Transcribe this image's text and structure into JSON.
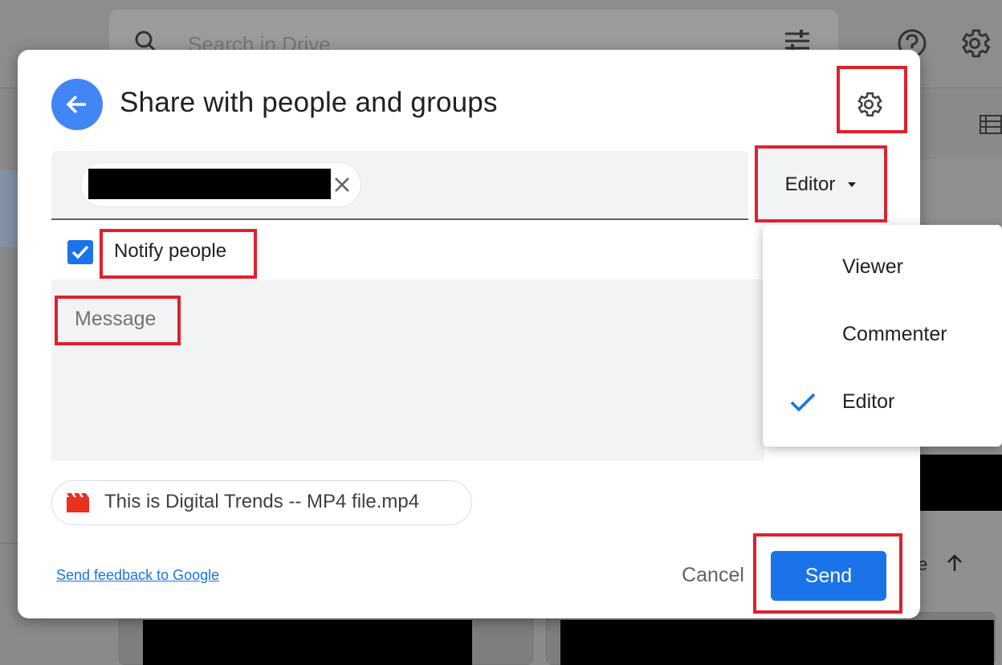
{
  "background": {
    "search_placeholder": "Search in Drive",
    "partial_text": "e"
  },
  "dialog": {
    "title": "Share with people and groups",
    "recipient_chip": {
      "redacted": true
    },
    "role_selector": {
      "selected": "Editor"
    },
    "notify": {
      "label": "Notify people",
      "checked": true
    },
    "message": {
      "placeholder": "Message"
    },
    "attachment": {
      "file_name": "This is Digital Trends -- MP4 file.mp4"
    },
    "footer": {
      "feedback_link": "Send feedback to Google",
      "cancel_label": "Cancel",
      "send_label": "Send"
    }
  },
  "role_menu": {
    "items": [
      {
        "label": "Viewer",
        "selected": false
      },
      {
        "label": "Commenter",
        "selected": false
      },
      {
        "label": "Editor",
        "selected": true
      }
    ]
  },
  "colors": {
    "accent": "#1a73e8",
    "back_button": "#4285f4",
    "annotation": "#e0202e"
  }
}
